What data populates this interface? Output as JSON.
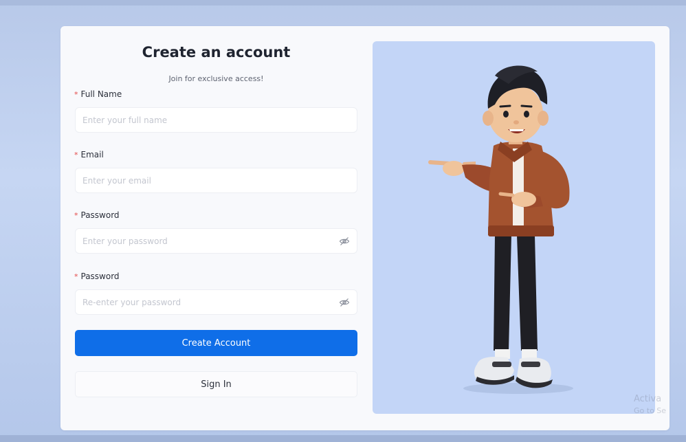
{
  "form": {
    "title": "Create an account",
    "subtitle": "Join for exclusive access!",
    "required_marker": "*",
    "fields": [
      {
        "label": "Full Name",
        "placeholder": "Enter your full name",
        "value": ""
      },
      {
        "label": "Email",
        "placeholder": "Enter your email",
        "value": ""
      },
      {
        "label": "Password",
        "placeholder": "Enter your password",
        "value": ""
      },
      {
        "label": "Password",
        "placeholder": "Re-enter your password",
        "value": ""
      }
    ],
    "create_label": "Create Account",
    "signin_label": "Sign In"
  },
  "illustration": {
    "name": "cartoon-man-pointing",
    "background": "#c3d5f7"
  },
  "watermark": {
    "line1": "Activa",
    "line2": "Go to Se"
  },
  "colors": {
    "primary": "#0f6ee8",
    "required": "#e34a4a",
    "page_background": "#c6d6f3"
  },
  "icons": {
    "password_toggle": "eye-off-icon"
  }
}
